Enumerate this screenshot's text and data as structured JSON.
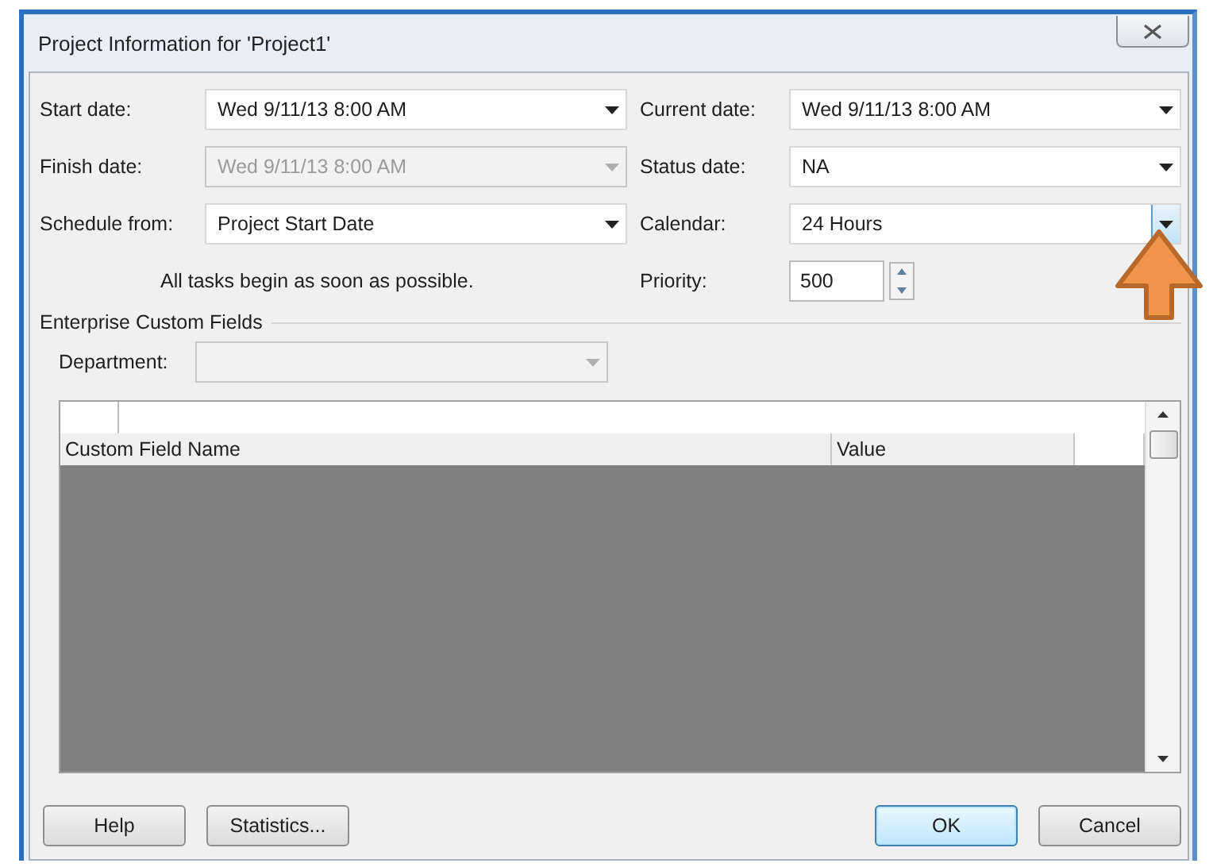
{
  "window": {
    "title": "Project Information for 'Project1'"
  },
  "left_fields": [
    {
      "kind": "combo",
      "label": "Start date:",
      "value": "Wed 9/11/13 8:00 AM",
      "disabled": false,
      "focused": false
    },
    {
      "kind": "combo",
      "label": "Finish date:",
      "value": "Wed 9/11/13 8:00 AM",
      "disabled": true,
      "focused": false
    },
    {
      "kind": "combo",
      "label": "Schedule from:",
      "value": "Project Start Date",
      "disabled": false,
      "focused": false
    }
  ],
  "note": "All tasks begin as soon as possible.",
  "right_fields": [
    {
      "kind": "combo",
      "label": "Current date:",
      "value": "Wed 9/11/13 8:00 AM",
      "disabled": false,
      "focused": false
    },
    {
      "kind": "combo",
      "label": "Status date:",
      "value": "NA",
      "disabled": false,
      "focused": false
    },
    {
      "kind": "combo",
      "label": "Calendar:",
      "value": "24 Hours",
      "disabled": false,
      "focused": true
    },
    {
      "kind": "spinner",
      "label": "Priority:",
      "value": "500",
      "disabled": false,
      "focused": false
    }
  ],
  "enterprise": {
    "title": "Enterprise Custom Fields",
    "department": {
      "label": "Department:",
      "disabled": true
    }
  },
  "table": {
    "columns": [
      "Custom Field Name",
      "Value"
    ]
  },
  "left_buttons": [
    {
      "label": "Help",
      "default": false
    },
    {
      "label": "Statistics...",
      "default": false
    }
  ],
  "right_buttons": [
    {
      "label": "OK",
      "default": true
    },
    {
      "label": "Cancel",
      "default": false
    }
  ]
}
